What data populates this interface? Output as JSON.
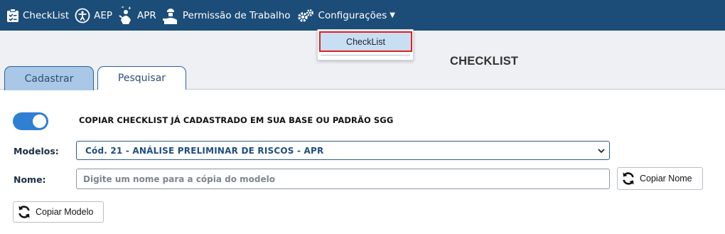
{
  "nav": {
    "items": [
      {
        "label": "CheckList",
        "icon": "clipboard-check-icon"
      },
      {
        "label": "AEP",
        "icon": "accessibility-icon"
      },
      {
        "label": "APR",
        "icon": "worker-icon"
      },
      {
        "label": "Permissão de Trabalho",
        "icon": "work-permit-icon"
      },
      {
        "label": "Configurações",
        "icon": "gears-icon"
      }
    ],
    "dropdown_item": "CheckList"
  },
  "header": {
    "title": "CHECKLIST",
    "tabs": [
      {
        "label": "Cadastrar",
        "active": true
      },
      {
        "label": "Pesquisar",
        "active": false
      }
    ]
  },
  "form": {
    "toggle_label": "COPIAR CHECKLIST JÁ CADASTRADO EM SUA BASE OU PADRÃO SGG",
    "toggle_on": true,
    "modelos_label": "Modelos:",
    "modelos_value": "Cód. 21 - ANÁLISE PRELIMINAR DE RISCOS - APR",
    "nome_label": "Nome:",
    "nome_placeholder": "Digite um nome para a cópia do modelo",
    "nome_value": "",
    "copiar_nome_button": "Copiar Nome",
    "copiar_modelo_button": "Copiar Modelo"
  },
  "colors": {
    "nav_bg": "#1c4d78",
    "accent": "#2f80d3",
    "highlight_border": "#e0201d"
  }
}
